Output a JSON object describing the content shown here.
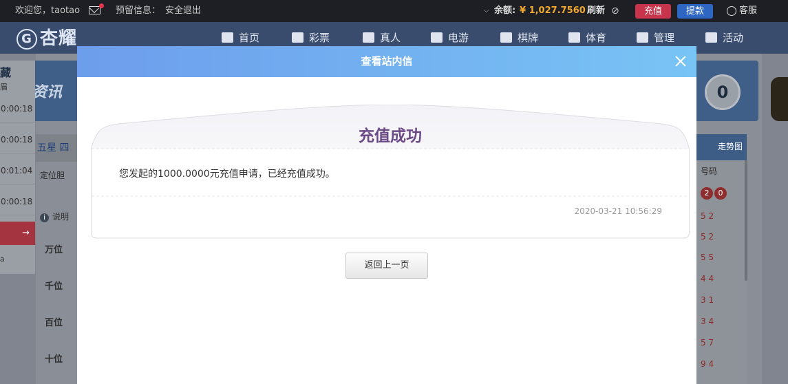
{
  "topbar": {
    "welcome": "欢迎您，",
    "username": "taotao",
    "reserved_info": "预留信息：",
    "logout": "安全退出",
    "balance_label": "余额:",
    "balance_value": "¥ 1,027.7560",
    "refresh": "刷新",
    "recharge": "充值",
    "withdraw": "提款",
    "customer_service": "客服"
  },
  "nav": {
    "logo_text": "杏耀",
    "items": [
      {
        "label": "首页",
        "icon": "home-icon"
      },
      {
        "label": "彩票",
        "icon": "ticket-icon"
      },
      {
        "label": "真人",
        "icon": "person-icon"
      },
      {
        "label": "电游",
        "icon": "slot-machine-icon"
      },
      {
        "label": "棋牌",
        "icon": "card-icon"
      },
      {
        "label": "体育",
        "icon": "trophy-icon"
      },
      {
        "label": "管理",
        "icon": "users-icon"
      },
      {
        "label": "活动",
        "icon": "gift-icon"
      }
    ]
  },
  "background": {
    "side_title": "藏",
    "side_sub": "眉",
    "side_times": [
      "0:00:18",
      "0:00:18",
      "0:01:04",
      "0:00:18"
    ],
    "side_extra": "a",
    "tabs": [
      "五星",
      "四"
    ],
    "left_rows": [
      "万位",
      "千位",
      "百位",
      "十位"
    ],
    "dingwei": "定位胆",
    "info": "说明",
    "banner_text": "资讯",
    "circle_value": "0",
    "right_head": "走势图",
    "right_sub": "号码",
    "right_balls": [
      "2",
      "0"
    ],
    "right_rows": [
      "5 2",
      "5 2",
      "5 5",
      "4 4",
      "3 1",
      "3 4",
      "5 7",
      "9 4"
    ]
  },
  "modal": {
    "title": "查看站内信",
    "letter_title": "充值成功",
    "letter_body": "您发起的1000.0000元充值申请，已经充值成功。",
    "letter_time": "2020-03-21 10:56:29",
    "back_button": "返回上一页"
  },
  "colors": {
    "header_gradient_start": "#6d9dec",
    "header_gradient_end": "#78c4f5",
    "letter_title": "#6b4a87",
    "recharge_button": "#c9344d",
    "withdraw_button": "#2e66c4",
    "balance": "#f0a830"
  }
}
